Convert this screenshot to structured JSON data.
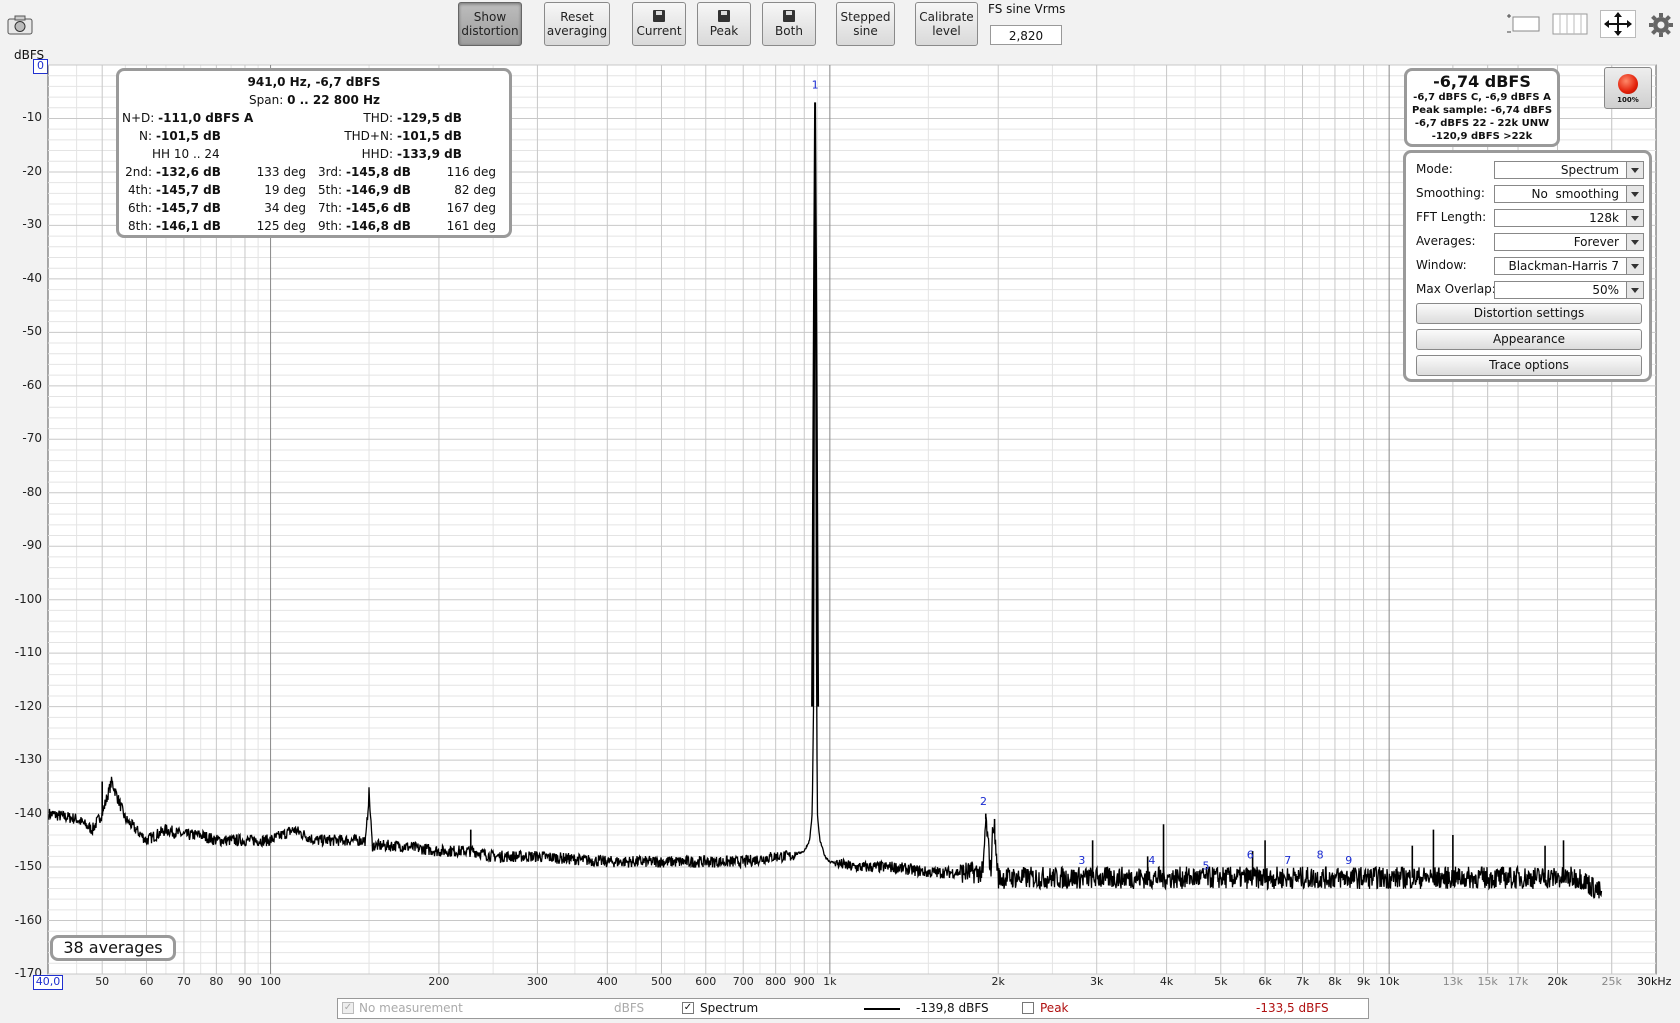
{
  "toolbar": {
    "show_distortion": [
      "Show",
      "distortion"
    ],
    "reset_averaging": [
      "Reset",
      "averaging"
    ],
    "current": "Current",
    "peak": "Peak",
    "both": "Both",
    "stepped_sine": [
      "Stepped",
      "sine"
    ],
    "calibrate_level": [
      "Calibrate",
      "level"
    ],
    "fs_label": "FS sine Vrms",
    "fs_value": "2,820"
  },
  "plot": {
    "ylabel": "dBFS",
    "ymax_box": "0",
    "xmin_box": "40,0",
    "xunit_label": "30kHz",
    "averages_label": "38 averages",
    "grid": true,
    "log_x": true,
    "colors": {
      "trace": "#000000",
      "harmonic_labels": "#1a2bd1",
      "peak_value": "#b01010",
      "background": "#ffffff"
    }
  },
  "distortion": {
    "title": "941,0 Hz, -6,7 dBFS",
    "span_label": "Span:",
    "span_value": "0 .. 22 800 Hz",
    "nd_label": "N+D:",
    "nd_value": "-111,0 dBFS A",
    "thd_label": "THD:",
    "thd_value": "-129,5 dB",
    "n_label": "N:",
    "n_value": "-101,5 dB",
    "thdn_label": "THD+N:",
    "thdn_value": "-101,5 dB",
    "hh_label": "HH 10 .. 24",
    "hhd_label": "HHD:",
    "hhd_value": "-133,9 dB",
    "harmonics": [
      {
        "label": "2nd:",
        "value": "-132,6 dB",
        "phase": "133 deg"
      },
      {
        "label": "3rd:",
        "value": "-145,8 dB",
        "phase": "116 deg"
      },
      {
        "label": "4th:",
        "value": "-145,7 dB",
        "phase": "19 deg"
      },
      {
        "label": "5th:",
        "value": "-146,9 dB",
        "phase": "82 deg"
      },
      {
        "label": "6th:",
        "value": "-145,7 dB",
        "phase": "34 deg"
      },
      {
        "label": "7th:",
        "value": "-145,6 dB",
        "phase": "167 deg"
      },
      {
        "label": "8th:",
        "value": "-146,1 dB",
        "phase": "125 deg"
      },
      {
        "label": "9th:",
        "value": "-146,8 dB",
        "phase": "161 deg"
      }
    ]
  },
  "level": {
    "main": "-6,74 dBFS",
    "line1": "-6,7 dBFS C, -6,9 dBFS A",
    "line2": "Peak sample: -6,74 dBFS",
    "line3": "-6,7 dBFS 22 - 22k UNW",
    "line4": "-120,9 dBFS >22k",
    "rec_pct": "100%"
  },
  "controls": {
    "mode_label": "Mode:",
    "mode_value": "Spectrum",
    "smoothing_label": "Smoothing:",
    "smoothing_value": "No  smoothing",
    "fft_label": "FFT Length:",
    "fft_value": "128k",
    "averages_label": "Averages:",
    "averages_value": "Forever",
    "window_label": "Window:",
    "window_value": "Blackman-Harris 7",
    "overlap_label": "Max Overlap:",
    "overlap_value": "50%",
    "distortion_settings": "Distortion settings",
    "appearance": "Appearance",
    "trace_options": "Trace options"
  },
  "legend": {
    "no_measurement": "No measurement",
    "no_measurement_unit": "dBFS",
    "spectrum": "Spectrum",
    "spectrum_value": "-139,8 dBFS",
    "peak": "Peak",
    "peak_value": "-133,5 dBFS"
  },
  "chart_data": {
    "type": "line",
    "title": "",
    "xlabel": "",
    "ylabel": "dBFS",
    "xscale": "log",
    "xlim": [
      40,
      30000
    ],
    "ylim": [
      -170,
      0
    ],
    "yticks": [
      "0",
      "-10",
      "-20",
      "-30",
      "-40",
      "-50",
      "-60",
      "-70",
      "-80",
      "-90",
      "-100",
      "-110",
      "-120",
      "-130",
      "-140",
      "-150",
      "-160",
      "-170"
    ],
    "xticks": [
      {
        "v": 50,
        "t": "50"
      },
      {
        "v": 60,
        "t": "60"
      },
      {
        "v": 70,
        "t": "70"
      },
      {
        "v": 80,
        "t": "80"
      },
      {
        "v": 90,
        "t": "90"
      },
      {
        "v": 100,
        "t": "100"
      },
      {
        "v": 200,
        "t": "200"
      },
      {
        "v": 300,
        "t": "300"
      },
      {
        "v": 400,
        "t": "400"
      },
      {
        "v": 500,
        "t": "500"
      },
      {
        "v": 600,
        "t": "600"
      },
      {
        "v": 700,
        "t": "700"
      },
      {
        "v": 800,
        "t": "800"
      },
      {
        "v": 900,
        "t": "900"
      },
      {
        "v": 1000,
        "t": "1k"
      },
      {
        "v": 2000,
        "t": "2k"
      },
      {
        "v": 3000,
        "t": "3k"
      },
      {
        "v": 4000,
        "t": "4k"
      },
      {
        "v": 5000,
        "t": "5k"
      },
      {
        "v": 6000,
        "t": "6k"
      },
      {
        "v": 7000,
        "t": "7k"
      },
      {
        "v": 8000,
        "t": "8k"
      },
      {
        "v": 9000,
        "t": "9k"
      },
      {
        "v": 10000,
        "t": "10k"
      },
      {
        "v": 13000,
        "t": "13k",
        "grey": true
      },
      {
        "v": 15000,
        "t": "15k",
        "grey": true
      },
      {
        "v": 17000,
        "t": "17k",
        "grey": true
      },
      {
        "v": 20000,
        "t": "20k"
      },
      {
        "v": 25000,
        "t": "25k",
        "grey": true
      }
    ],
    "series": [
      {
        "name": "Spectrum",
        "x": [
          40,
          45,
          48,
          50,
          52,
          55,
          60,
          65,
          70,
          75,
          80,
          90,
          100,
          110,
          120,
          140,
          148,
          150,
          152,
          170,
          200,
          230,
          250,
          300,
          400,
          500,
          600,
          700,
          800,
          850,
          900,
          920,
          930,
          935,
          938,
          941,
          944,
          947,
          950,
          955,
          960,
          980,
          1000,
          1100,
          1300,
          1500,
          1700,
          1880,
          1900,
          1940,
          1960,
          2000,
          2500,
          3000,
          3500,
          4000,
          5000,
          6000,
          7000,
          8000,
          9000,
          10000,
          12000,
          15000,
          18000,
          20000,
          22000,
          24000
        ],
        "y": [
          -140,
          -141,
          -143,
          -140,
          -134,
          -141,
          -145,
          -143,
          -144,
          -144,
          -145,
          -145,
          -145,
          -143,
          -145,
          -145,
          -145,
          -136,
          -146,
          -146,
          -147,
          -147,
          -148,
          -148,
          -149,
          -149,
          -149,
          -149,
          -148,
          -148,
          -147,
          -145,
          -140,
          -120,
          -60,
          -7,
          -60,
          -120,
          -140,
          -143,
          -145,
          -148,
          -149,
          -150,
          -150,
          -151,
          -151,
          -151,
          -141,
          -151,
          -141,
          -152,
          -152,
          -152,
          -152,
          -152,
          -152,
          -152,
          -152,
          -152,
          -152,
          -152,
          -152,
          -152,
          -152,
          -152,
          -152,
          -155
        ]
      }
    ],
    "spurs": [
      {
        "x": 50,
        "y": -134
      },
      {
        "x": 150,
        "y": -136
      },
      {
        "x": 228,
        "y": -143
      },
      {
        "x": 1900,
        "y": -140
      },
      {
        "x": 1970,
        "y": -141
      },
      {
        "x": 2950,
        "y": -145
      },
      {
        "x": 3700,
        "y": -148
      },
      {
        "x": 3950,
        "y": -142
      },
      {
        "x": 5700,
        "y": -147
      },
      {
        "x": 6000,
        "y": -145
      },
      {
        "x": 11000,
        "y": -146
      },
      {
        "x": 12000,
        "y": -143
      },
      {
        "x": 13000,
        "y": -144
      },
      {
        "x": 19000,
        "y": -146
      },
      {
        "x": 20500,
        "y": -145
      }
    ],
    "harmonic_markers": [
      {
        "label": "1",
        "x": 941,
        "y": -5
      },
      {
        "label": "2",
        "x": 1882,
        "y": -139
      },
      {
        "label": "3",
        "x": 2823,
        "y": -150
      },
      {
        "label": "4",
        "x": 3764,
        "y": -150
      },
      {
        "label": "5",
        "x": 4705,
        "y": -151
      },
      {
        "label": "6",
        "x": 5646,
        "y": -149
      },
      {
        "label": "7",
        "x": 6587,
        "y": -150
      },
      {
        "label": "8",
        "x": 7528,
        "y": -149
      },
      {
        "label": "9",
        "x": 8469,
        "y": -150
      }
    ]
  }
}
